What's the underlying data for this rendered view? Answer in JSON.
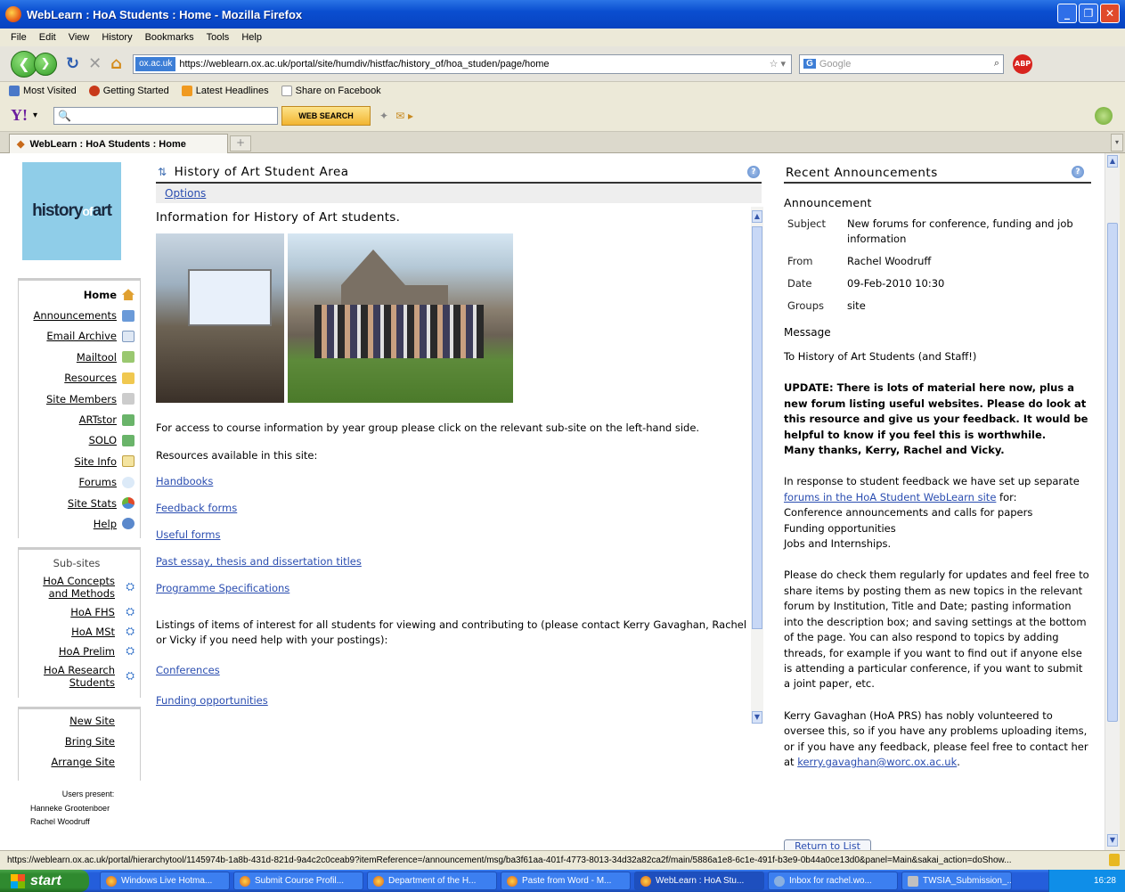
{
  "window": {
    "title": "WebLearn : HoA Students : Home - Mozilla Firefox"
  },
  "menu": [
    "File",
    "Edit",
    "View",
    "History",
    "Bookmarks",
    "Tools",
    "Help"
  ],
  "nav": {
    "site_badge": "ox.ac.uk",
    "url": "https://weblearn.ox.ac.uk/portal/site/humdiv/histfac/history_of/hoa_studen/page/home",
    "search_placeholder": "Google"
  },
  "bookmarks": [
    "Most Visited",
    "Getting Started",
    "Latest Headlines",
    "Share on Facebook"
  ],
  "yahoo": {
    "web_search": "WEB SEARCH"
  },
  "tab": {
    "label": "WebLearn : HoA Students : Home"
  },
  "logo": {
    "text_a": "history",
    "text_b": "of",
    "text_c": "art"
  },
  "sidebar": {
    "items": [
      "Home",
      "Announcements",
      "Email Archive",
      "Mailtool",
      "Resources",
      "Site Members",
      "ARTstor",
      "SOLO",
      "Site Info",
      "Forums",
      "Site Stats",
      "Help"
    ],
    "subsites_label": "Sub-sites",
    "subsites": [
      "HoA Concepts and Methods",
      "HoA FHS",
      "HoA MSt",
      "HoA Prelim",
      "HoA Research Students"
    ],
    "site_actions": [
      "New Site",
      "Bring Site",
      "Arrange Site"
    ],
    "users_label": "Users present:",
    "users": [
      "Hanneke Grootenboer",
      "Rachel Woodruff"
    ]
  },
  "main": {
    "title": "History of Art Student Area",
    "options": "Options",
    "heading": "Information for History of Art students.",
    "p1": "For access to course information by year group please click on the relevant sub-site on the left-hand side.",
    "p2": "Resources available in this site:",
    "links1": [
      "Handbooks",
      "Feedback forms",
      "Useful forms",
      "Past essay, thesis and dissertation titles",
      "Programme Specifications"
    ],
    "p3": "Listings of items of interest for all students for viewing and contributing to (please contact Kerry Gavaghan, Rachel or Vicky if you need help with your postings):",
    "links2": [
      "Conferences",
      "Funding opportunities"
    ]
  },
  "announcements": {
    "title": "Recent Announcements",
    "heading": "Announcement",
    "subject_k": "Subject",
    "subject_v": "New forums for conference, funding and job information",
    "from_k": "From",
    "from_v": "Rachel Woodruff",
    "date_k": "Date",
    "date_v": "09-Feb-2010 10:30",
    "groups_k": "Groups",
    "groups_v": "site",
    "message_label": "Message",
    "m1": "To History of Art Students (and Staff!)",
    "m2": "UPDATE: There is lots of material here now, plus a new forum listing useful websites.  Please do look at this resource and give us your feedback.  It would be helpful to know if you feel this is worthwhile.",
    "m2b": "Many thanks, Kerry, Rachel and Vicky.",
    "m3a": "In response to student feedback we have set up separate ",
    "m3link": "forums in the HoA Student WebLearn site",
    "m3b": " for:",
    "m3l1": "Conference announcements and calls for papers",
    "m3l2": "Funding opportunities",
    "m3l3": "Jobs and Internships.",
    "m4": "Please do check them regularly for updates and feel free to share items by posting them as new topics in the relevant forum by Institution, Title and Date; pasting information into the description box; and saving settings at the bottom of the page.  You can also respond to topics by adding threads, for example if you want to find out if anyone else is attending a particular conference, if you want to submit a joint paper, etc.",
    "m5a": "Kerry Gavaghan (HoA PRS) has nobly volunteered to oversee this, so if you have any problems uploading items, or if you have any feedback, please feel free to contact her at ",
    "m5link": "kerry.gavaghan@worc.ox.ac.uk",
    "m5b": ".",
    "return": "Return to List"
  },
  "status": {
    "text": "https://weblearn.ox.ac.uk/portal/hierarchytool/1145974b-1a8b-431d-821d-9a4c2c0ceab9?itemReference=/announcement/msg/ba3f61aa-401f-4773-8013-34d32a82ca2f/main/5886a1e8-6c1e-491f-b3e9-0b44a0ce13d0&panel=Main&sakai_action=doShow..."
  },
  "taskbar": {
    "start": "start",
    "tasks": [
      "Windows Live Hotma...",
      "Submit Course Profil...",
      "Department of the H...",
      "Paste from Word - M...",
      "WebLearn : HoA Stu...",
      "Inbox for rachel.wo...",
      "TWSIA_Submission_..."
    ],
    "clock": "16:28"
  }
}
